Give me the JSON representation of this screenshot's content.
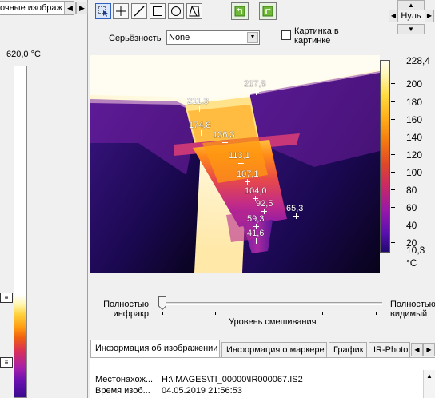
{
  "left_panel": {
    "tab_label": "очные изображ",
    "scroll_left": "◀",
    "scroll_right": "▶",
    "max_temp": "620,0 °C",
    "marker_upper": "≡",
    "marker_lower": "≡"
  },
  "toolbar": {
    "tools": [
      "select-tool",
      "point-tool",
      "line-tool",
      "rectangle-tool",
      "ellipse-tool",
      "polygon-tool"
    ],
    "undo_icon": "rotate-left-icon",
    "redo_icon": "rotate-right-icon"
  },
  "zoom": {
    "value": "Нуль",
    "up": "▲",
    "down": "▼",
    "left": "◀",
    "right": "▶"
  },
  "severity": {
    "label": "Серьёзность",
    "value": "None",
    "arrow": "▼"
  },
  "picture_in_picture": {
    "label_line1": "Картинка в",
    "label_line2": "картинке",
    "checked": false
  },
  "thermal_image": {
    "palette": "iron",
    "spots": [
      {
        "label": "217,8",
        "value": 217.8
      },
      {
        "label": "211,3",
        "value": 211.3
      },
      {
        "label": "174,8",
        "value": 174.8
      },
      {
        "label": "136,3",
        "value": 136.3
      },
      {
        "label": "113,1",
        "value": 113.1
      },
      {
        "label": "107,1",
        "value": 107.1
      },
      {
        "label": "104,0",
        "value": 104.0
      },
      {
        "label": "92,5",
        "value": 92.5
      },
      {
        "label": "65,3",
        "value": 65.3
      },
      {
        "label": "59,3",
        "value": 59.3
      },
      {
        "label": "41,6",
        "value": 41.6
      }
    ]
  },
  "scale": {
    "max": "228,4",
    "min": "10,3",
    "unit": "°C",
    "ticks": [
      "200",
      "180",
      "160",
      "140",
      "120",
      "100",
      "80",
      "60",
      "40",
      "20"
    ]
  },
  "blend": {
    "left_line1": "Полностью",
    "left_line2": "инфракр",
    "right_line1": "Полностью",
    "right_line2": "видимый",
    "caption": "Уровень смешивания",
    "level": 0
  },
  "tabs": [
    {
      "label": "Информация об изображении",
      "active": true
    },
    {
      "label": "Информация о маркере",
      "active": false
    },
    {
      "label": "График",
      "active": false
    },
    {
      "label": "IR-PhotoN",
      "active": false
    }
  ],
  "tab_scroll": {
    "left": "◀",
    "right": "▶"
  },
  "info": {
    "rows": [
      {
        "key": "Местонахож...",
        "value": "H:\\IMAGES\\TI_00000\\IR000067.IS2"
      },
      {
        "key": "Время изоб...",
        "value": "04.05.2019 21:56:53"
      }
    ],
    "scroll_up": "▲"
  }
}
